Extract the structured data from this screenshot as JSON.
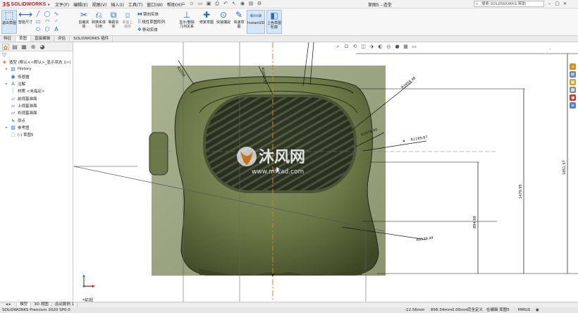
{
  "titlebar": {
    "brand": "SOLIDWORKS",
    "menus": [
      "文件(F)",
      "编辑(E)",
      "视图(V)",
      "插入(I)",
      "工具(T)",
      "窗口(W)",
      "帮助(H)"
    ],
    "document_title": "草图5 - 造型",
    "search_placeholder": "搜索 SOLIDWORKS 帮助"
  },
  "ribbon": {
    "exit_sketch": "退出草图",
    "smart_dim": "智能尺寸",
    "trim": "剪裁实体",
    "convert": "转换实体引用",
    "offset": "等距实体",
    "surface_offset": "曲面上偏移",
    "mirror": "镜向实体",
    "linear_pattern": "线性草图阵列",
    "move": "移动实体",
    "relations": "显示/删除几何关系",
    "repair": "修复草图",
    "quick_snaps": "快速捕捉",
    "rapid_sketch": "快速草图",
    "instant2d": "Instant2D",
    "shaded_contours": "上色草图轮廓"
  },
  "command_tabs": [
    "特征",
    "草图",
    "直接编辑",
    "评估",
    "SOLIDWORKS 插件"
  ],
  "tree": {
    "root": "造型 (默认<<默认>_显示状态 1>)",
    "items": [
      "History",
      "传感器",
      "注解",
      "材质 <未指定>",
      "前视基准面",
      "上视基准面",
      "右视基准面",
      "原点",
      "参考图",
      "(-) 草图5"
    ]
  },
  "dimensions": {
    "d_top_left": "R3356",
    "d_top_middle": "R1660.37",
    "d_inner_right": "R3958.48",
    "d_mid_right1": "R1978.40",
    "d_mid_right2": "R1189.87",
    "d_lower_right": "R5579.44",
    "d_height1": "1479.95",
    "d_height2": "1851.57",
    "d_height3": "894.99",
    "triad_label": "*前视"
  },
  "watermark": {
    "brand": "沐风网",
    "url": "www.mfcad.com"
  },
  "sheet_tabs": [
    "模型",
    "3D 视图",
    "运动算例 1"
  ],
  "status": {
    "product": "SOLIDWORKS Premium 2020 SP0.0",
    "x": "-12.56mm",
    "y": "856.34mm",
    "z": "0.00mm",
    "definition": "完全定义",
    "mode": "在编辑 草图5",
    "units": "MMGS"
  },
  "colors": {
    "accent": "#2b6cb0",
    "brand_red": "#c41e24",
    "sketch_green": "#6b7a44",
    "dim_black": "#111111",
    "centerline_orange": "#e07b1a"
  }
}
